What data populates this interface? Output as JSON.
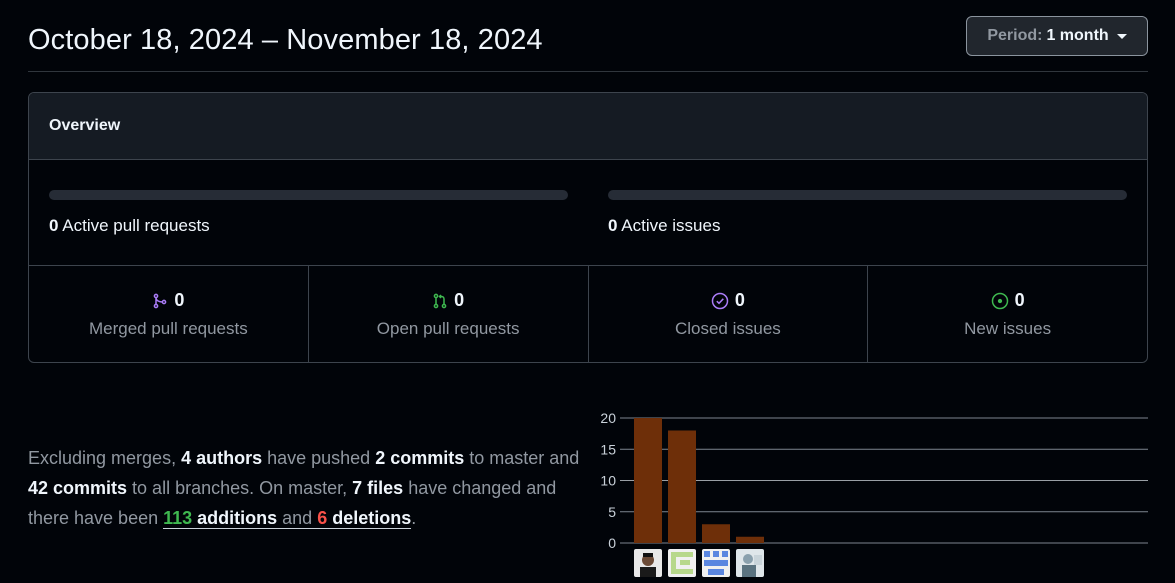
{
  "header": {
    "date_range": "October 18, 2024 – November 18, 2024",
    "period_label": "Period:",
    "period_value": "1 month"
  },
  "overview": {
    "title": "Overview",
    "active_prs": {
      "count": "0",
      "label": "Active pull requests"
    },
    "active_issues": {
      "count": "0",
      "label": "Active issues"
    },
    "stats": [
      {
        "count": "0",
        "label": "Merged pull requests",
        "icon": "git-merge-icon",
        "color": "#ab7df8"
      },
      {
        "count": "0",
        "label": "Open pull requests",
        "icon": "git-pull-request-icon",
        "color": "#3fb950"
      },
      {
        "count": "0",
        "label": "Closed issues",
        "icon": "issue-closed-icon",
        "color": "#ab7df8"
      },
      {
        "count": "0",
        "label": "New issues",
        "icon": "issue-opened-icon",
        "color": "#3fb950"
      }
    ]
  },
  "summary": {
    "p1": "Excluding merges, ",
    "authors": "4 authors",
    "p2": " have pushed ",
    "commits_master": "2 commits",
    "p3": " to master and ",
    "commits_all": "42 commits",
    "p4": " to all branches. On master, ",
    "files": "7 files",
    "p5": " have changed and there have been ",
    "additions_num": "113",
    "additions_word": " additions",
    "p6": " and ",
    "deletions_num": "6",
    "deletions_word": " deletions",
    "p7": "."
  },
  "chart_data": {
    "type": "bar",
    "categories": [
      "author-1",
      "author-2",
      "author-3",
      "author-4"
    ],
    "values": [
      20,
      18,
      3,
      1
    ],
    "yticks": [
      "0",
      "5",
      "10",
      "15",
      "20"
    ],
    "ylim": [
      0,
      20
    ],
    "bar_color": "#6e2f09",
    "grid": true
  }
}
